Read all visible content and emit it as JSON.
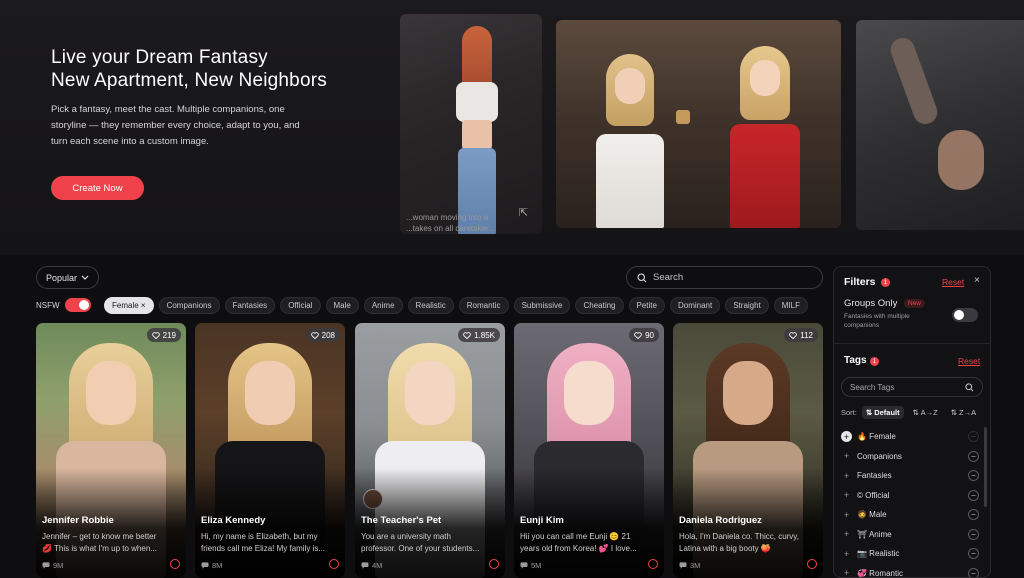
{
  "hero": {
    "title_line1": "Live your Dream Fantasy",
    "title_line2": "New Apartment, New Neighbors",
    "description": "Pick a fantasy, meet the cast. Multiple companions, one storyline — they remember every choice, adapt to you, and turn each scene into a custom image.",
    "cta_label": "Create Now",
    "image1_caption_line1": "...woman moving into a",
    "image1_caption_line2": "...takes on all caretaker...",
    "accent_color": "#f0424a"
  },
  "toolbar": {
    "sort_label": "Popular",
    "search_placeholder": "Search",
    "nsfw_label": "NSFW",
    "nsfw_on": true
  },
  "tag_chips": [
    {
      "label": "Female ×",
      "active": true
    },
    {
      "label": "Companions",
      "active": false
    },
    {
      "label": "Fantasies",
      "active": false
    },
    {
      "label": "Official",
      "active": false
    },
    {
      "label": "Male",
      "active": false
    },
    {
      "label": "Anime",
      "active": false
    },
    {
      "label": "Realistic",
      "active": false
    },
    {
      "label": "Romantic",
      "active": false
    },
    {
      "label": "Submissive",
      "active": false
    },
    {
      "label": "Cheating",
      "active": false
    },
    {
      "label": "Petite",
      "active": false
    },
    {
      "label": "Dominant",
      "active": false
    },
    {
      "label": "Straight",
      "active": false
    },
    {
      "label": "MILF",
      "active": false
    }
  ],
  "cards": [
    {
      "name": "Jennifer Robbie",
      "likes": "219",
      "views": "9M",
      "line1": "Jennifer – get to know me better",
      "line2": "💋 This is what I'm up to when..."
    },
    {
      "name": "Eliza Kennedy",
      "likes": "208",
      "views": "8M",
      "line1": "Hi, my name is Elizabeth, but my",
      "line2": "friends call me Eliza! My family is..."
    },
    {
      "name": "The Teacher's Pet",
      "likes": "1.85K",
      "views": "4M",
      "line1": "You are a university math",
      "line2": "professor. One of your students..."
    },
    {
      "name": "Eunji Kim",
      "likes": "90",
      "views": "5M",
      "line1": "Hii you can call me Eunji 😊 21",
      "line2": "years old from Korea! 💕 I love..."
    },
    {
      "name": "Daniela Rodriguez",
      "likes": "112",
      "views": "3M",
      "line1": "Hola, I'm Daniela co. Thicc, curvy,",
      "line2": "Latina with a big booty 🍑"
    }
  ],
  "filters": {
    "title": "Filters",
    "badge": "1",
    "reset_label": "Reset",
    "close_glyph": "×",
    "groups_label": "Groups Only",
    "new_label": "New",
    "groups_desc": "Fantasies with multiple companions",
    "tags_title": "Tags",
    "tags_badge": "1",
    "tags_reset": "Reset",
    "tag_search_placeholder": "Search Tags",
    "sort_label": "Sort:",
    "sort_default": "⇅ Default",
    "sort_az": "⇅ A→Z",
    "sort_za": "⇅ Z→A",
    "tags": [
      {
        "label": "🔥 Female",
        "selected": true
      },
      {
        "label": "Companions",
        "selected": false
      },
      {
        "label": "Fantasies",
        "selected": false
      },
      {
        "label": "© Official",
        "selected": false
      },
      {
        "label": "🧔 Male",
        "selected": false
      },
      {
        "label": "⛩ Anime",
        "selected": false
      },
      {
        "label": "📷 Realistic",
        "selected": false
      },
      {
        "label": "💞 Romantic",
        "selected": false
      }
    ]
  }
}
